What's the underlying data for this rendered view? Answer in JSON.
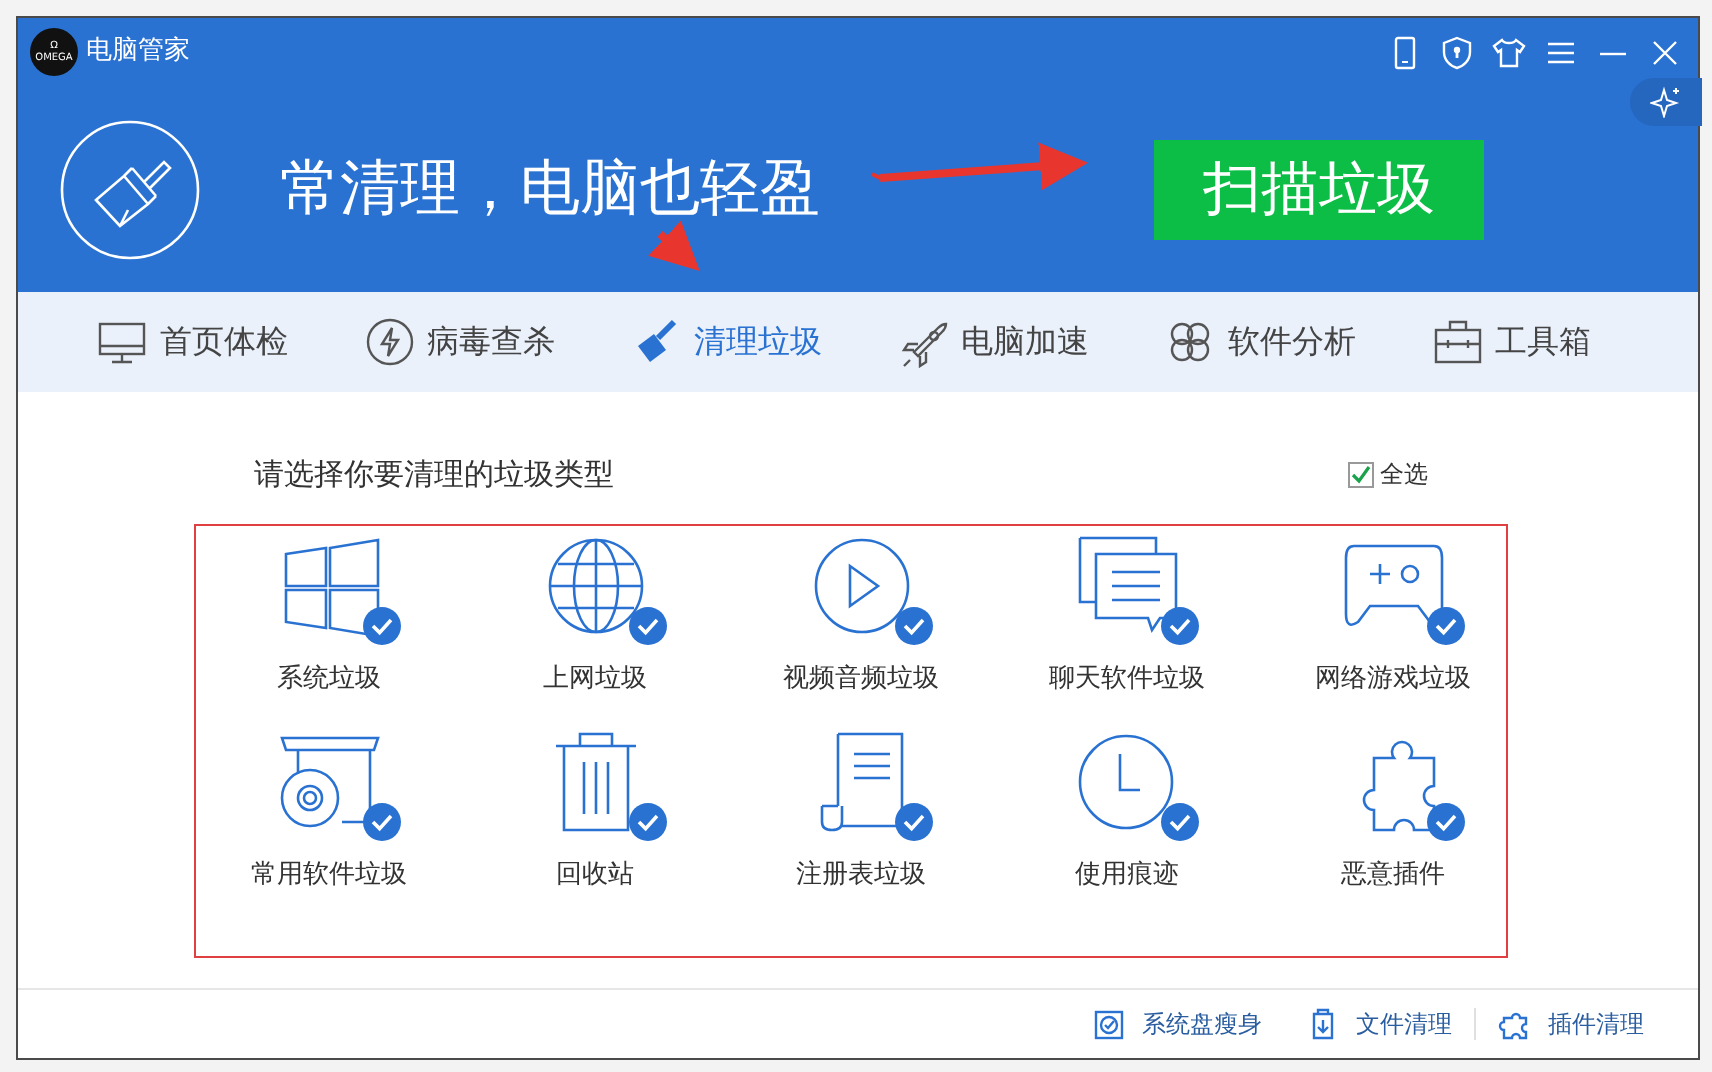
{
  "window": {
    "title": "电脑管家",
    "logo": "Ω\nOMEGA"
  },
  "controls": [
    {
      "kind": "phone"
    },
    {
      "kind": "shield"
    },
    {
      "kind": "shirt"
    },
    {
      "kind": "menu"
    },
    {
      "kind": "minimize"
    },
    {
      "kind": "close"
    }
  ],
  "hero": {
    "slogan": "常清理，电脑也轻盈",
    "action": "扫描垃圾"
  },
  "tabs": [
    {
      "label": "首页体检",
      "kind": "monitor",
      "selected": false
    },
    {
      "label": "病毒查杀",
      "kind": "bolt",
      "selected": false
    },
    {
      "label": "清理垃圾",
      "kind": "broom",
      "selected": true
    },
    {
      "label": "电脑加速",
      "kind": "rocket",
      "selected": false
    },
    {
      "label": "软件分析",
      "kind": "clover",
      "selected": false
    },
    {
      "label": "工具箱",
      "kind": "toolbox",
      "selected": false
    }
  ],
  "prompt": "请选择你要清理的垃圾类型",
  "select_all": {
    "label": "全选",
    "checked": true
  },
  "categories": [
    {
      "label": "系统垃圾",
      "kind": "windows",
      "checked": true
    },
    {
      "label": "上网垃圾",
      "kind": "globe",
      "checked": true
    },
    {
      "label": "视频音频垃圾",
      "kind": "play",
      "checked": true
    },
    {
      "label": "聊天软件垃圾",
      "kind": "chat",
      "checked": true
    },
    {
      "label": "网络游戏垃圾",
      "kind": "gamepad",
      "checked": true
    },
    {
      "label": "常用软件垃圾",
      "kind": "disc",
      "checked": true
    },
    {
      "label": "回收站",
      "kind": "trash",
      "checked": true
    },
    {
      "label": "注册表垃圾",
      "kind": "scroll",
      "checked": true
    },
    {
      "label": "使用痕迹",
      "kind": "clock",
      "checked": true
    },
    {
      "label": "恶意插件",
      "kind": "puzzle",
      "checked": true
    }
  ],
  "footer_links": [
    {
      "label": "系统盘瘦身",
      "kind": "disk"
    },
    {
      "label": "文件清理",
      "kind": "download"
    },
    {
      "label": "插件清理",
      "kind": "puzzle"
    }
  ]
}
